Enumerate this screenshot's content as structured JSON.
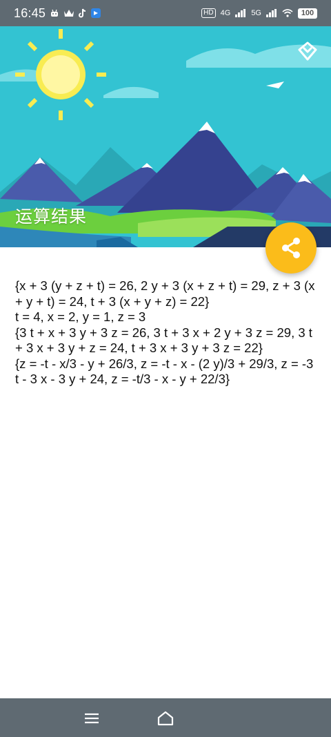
{
  "status_bar": {
    "time": "16:45",
    "network_badge": "HD",
    "signal_1": "4G",
    "signal_2": "5G",
    "battery": "100"
  },
  "header": {
    "title": "运算结果",
    "colors": {
      "sky": "#32c4d3",
      "sun": "#f8ec52",
      "fab": "#fbbc1a"
    }
  },
  "result": {
    "lines": [
      "{x + 3 (y + z + t) = 26, 2 y + 3 (x + z + t) = 29, z + 3 (x + y + t) = 24, t + 3 (x + y + z) = 22}",
      "t = 4, x = 2, y = 1, z = 3",
      "{3 t + x + 3 y + 3 z = 26, 3 t + 3 x + 2 y + 3 z = 29, 3 t + 3 x + 3 y + z = 24, t + 3 x + 3 y + 3 z = 22}",
      "{z = -t - x/3 - y + 26/3, z = -t - x - (2 y)/3 + 29/3, z = -3 t - 3 x - 3 y + 24, z = -t/3 - x - y + 22/3}"
    ]
  },
  "icons": {
    "share": "share-icon",
    "header_action": "diamond-chevron-icon",
    "nav_menu": "menu-icon",
    "nav_home": "home-icon"
  }
}
